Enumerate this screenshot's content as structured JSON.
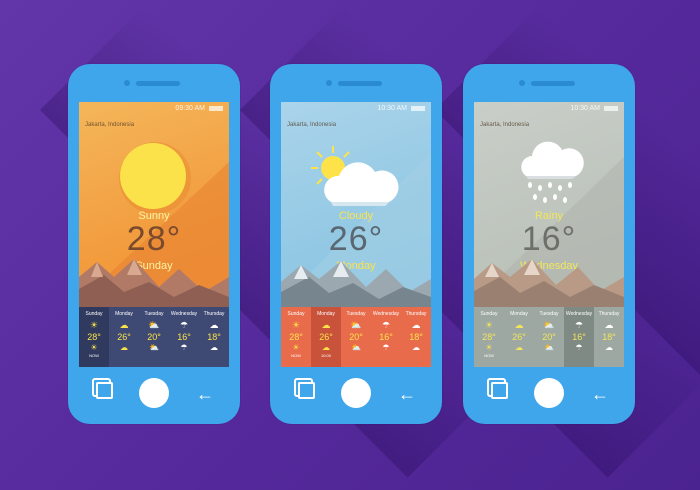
{
  "phones": [
    {
      "time": "09:30 AM",
      "location": "Jakarta, Indonesia",
      "condition": "Sunny",
      "temp": "28°",
      "day": "Sunday",
      "forecast": [
        {
          "day": "Sunday",
          "icon": "☀",
          "temp": "28°",
          "night": "☀",
          "sub": "NOW"
        },
        {
          "day": "Monday",
          "icon": "☁",
          "temp": "26°",
          "night": "☁",
          "sub": ""
        },
        {
          "day": "Tuesday",
          "icon": "⛅",
          "temp": "20°",
          "night": "⛅",
          "sub": ""
        },
        {
          "day": "Wednesday",
          "icon": "☂",
          "temp": "16°",
          "night": "☂",
          "sub": ""
        },
        {
          "day": "Thursday",
          "icon": "☁",
          "temp": "18°",
          "night": "☁",
          "sub": ""
        }
      ]
    },
    {
      "time": "10:30 AM",
      "location": "Jakarta, Indonesia",
      "condition": "Cloudy",
      "temp": "26°",
      "day": "Monday",
      "forecast": [
        {
          "day": "Sunday",
          "icon": "☀",
          "temp": "28°",
          "night": "☀",
          "sub": "NOW"
        },
        {
          "day": "Monday",
          "icon": "☁",
          "temp": "26°",
          "night": "☁",
          "sub": "10:00"
        },
        {
          "day": "Tuesday",
          "icon": "⛅",
          "temp": "20°",
          "night": "⛅",
          "sub": ""
        },
        {
          "day": "Wednesday",
          "icon": "☂",
          "temp": "16°",
          "night": "☂",
          "sub": ""
        },
        {
          "day": "Thursday",
          "icon": "☁",
          "temp": "18°",
          "night": "☁",
          "sub": ""
        }
      ]
    },
    {
      "time": "10:30 AM",
      "location": "Jakarta, Indonesia",
      "condition": "Rainy",
      "temp": "16°",
      "day": "Wednesday",
      "forecast": [
        {
          "day": "Sunday",
          "icon": "☀",
          "temp": "28°",
          "night": "☀",
          "sub": "NOW"
        },
        {
          "day": "Monday",
          "icon": "☁",
          "temp": "26°",
          "night": "☁",
          "sub": ""
        },
        {
          "day": "Tuesday",
          "icon": "⛅",
          "temp": "20°",
          "night": "⛅",
          "sub": ""
        },
        {
          "day": "Wednesday",
          "icon": "☂",
          "temp": "16°",
          "night": "☂",
          "sub": ""
        },
        {
          "day": "Thursday",
          "icon": "☁",
          "temp": "18°",
          "night": "☁",
          "sub": ""
        }
      ]
    }
  ],
  "icons": [
    "sun-icon",
    "cloud-icon",
    "rain-cloud-icon",
    "multitask-icon",
    "home-button",
    "back-arrow-icon"
  ]
}
